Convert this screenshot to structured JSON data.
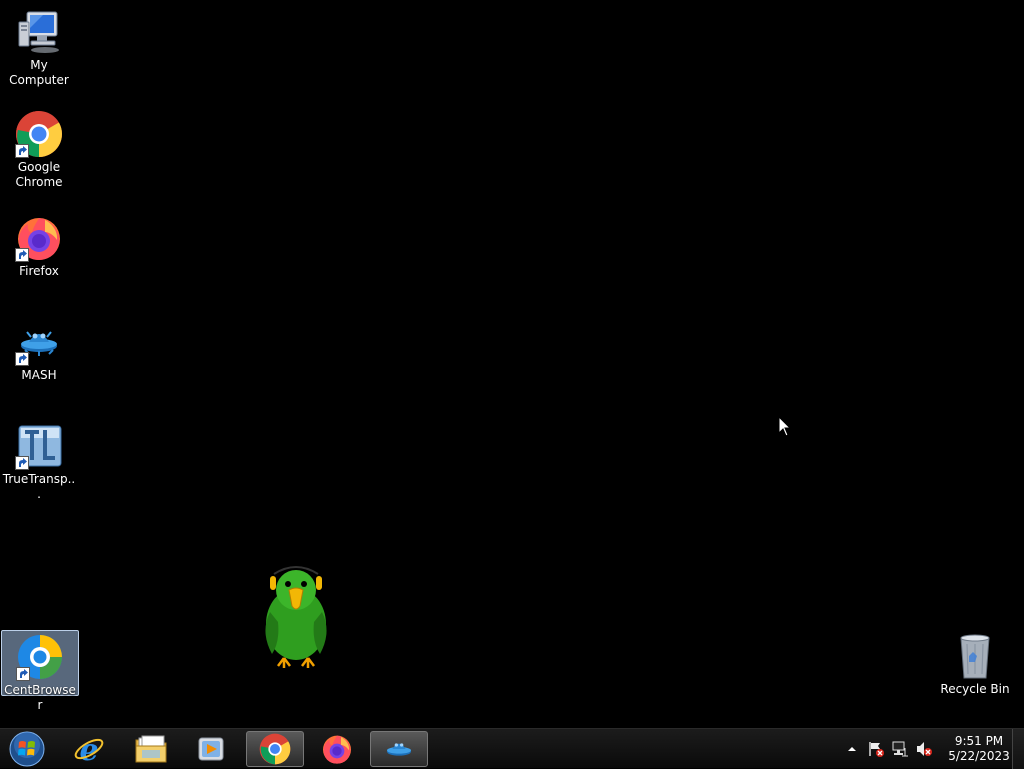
{
  "desktop": {
    "icons": [
      {
        "label": "My Computer"
      },
      {
        "label": "Google Chrome"
      },
      {
        "label": "Firefox"
      },
      {
        "label": "MASH"
      },
      {
        "label": "TrueTransp..."
      },
      {
        "label": "CentBrowser"
      },
      {
        "label": "Recycle Bin"
      }
    ],
    "selected_icon": "CentBrowser"
  },
  "taskbar": {
    "pinned": [
      {
        "icon": "start-orb-icon"
      },
      {
        "icon": "internet-explorer-icon"
      },
      {
        "icon": "file-explorer-icon"
      },
      {
        "icon": "media-player-icon"
      },
      {
        "icon": "chrome-icon",
        "active": true
      },
      {
        "icon": "firefox-icon"
      },
      {
        "icon": "mash-icon",
        "active": true
      }
    ],
    "tray": {
      "icons": [
        "show-hidden-icons",
        "action-center-flag-icon",
        "network-icon",
        "volume-muted-icon"
      ],
      "time": "9:51 PM",
      "date": "5/22/2023"
    }
  },
  "colors": {
    "desktop_background": "#000000",
    "taskbar": "#111111",
    "selection": "#a0bee1"
  }
}
